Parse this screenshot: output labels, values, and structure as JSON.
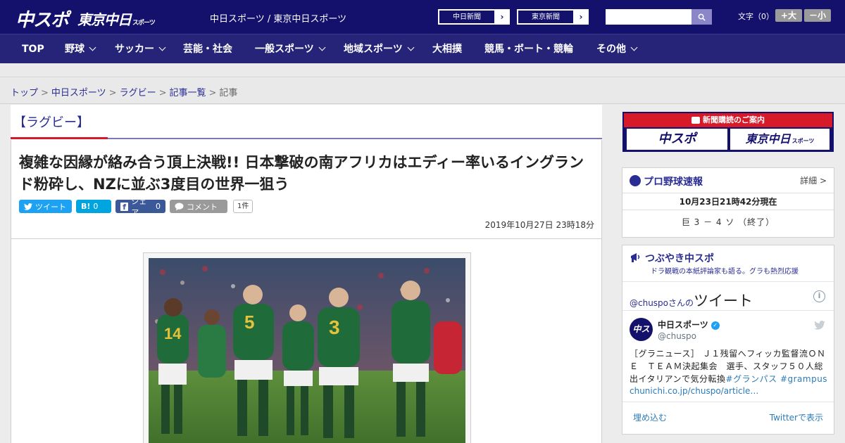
{
  "header": {
    "logo_chuspo": "中スポ",
    "logo_tokyo": "東京中日",
    "logo_tokyo_sub": "スポーツ",
    "site_name": "中日スポーツ / 東京中日スポーツ",
    "ext_links": [
      "中日新聞",
      "東京新聞"
    ],
    "search_placeholder": "",
    "fontsize_label": "文字（0）",
    "font_up": "+大",
    "font_down": "－小"
  },
  "nav": {
    "items": [
      "TOP",
      "野球",
      "サッカー",
      "芸能・社会",
      "一般スポーツ",
      "地域スポーツ",
      "大相撲",
      "競馬・ボート・競輪",
      "その他"
    ]
  },
  "breadcrumb": {
    "items": [
      "トップ",
      "中日スポーツ",
      "ラグビー",
      "記事一覧"
    ],
    "current": "記事",
    "sep": ">"
  },
  "article": {
    "category": "【ラグビー】",
    "headline": "複雑な因縁が絡み合う頂上決戦!! 日本撃破の南アフリカはエディー率いるイングランド粉砕し、NZに並ぶ3度目の世界一狙う",
    "share": {
      "tweet": "ツイート",
      "hatena_icon": "B!",
      "hatena_count": "0",
      "facebook": "シェア",
      "facebook_count": "0",
      "comment": "コメント",
      "comment_count": "1件"
    },
    "date": "2019年10月27日 23時18分"
  },
  "sidebar": {
    "ad_title": "新聞購読のご案内",
    "ad_logo_1": "中スポ",
    "ad_logo_2": "東京中日",
    "ad_logo_2_sub": "スポーツ",
    "baseball": {
      "title": "プロ野球速報",
      "more": "詳細 >",
      "time": "10月23日21時42分現在",
      "score": "巨 3 － 4 ソ （終了）"
    },
    "tsubuyaki": {
      "title": "つぶやき中スポ",
      "subtitle": "ドラ観戦の本紙評論家も語る。グラも熱烈応援",
      "tweets_by_handle": "@chuspo",
      "tweets_by_suffix": "さんの",
      "tweets_by_word": "ツイート",
      "name": "中日スポーツ",
      "handle": "@chuspo",
      "avatar_text": "中スポ",
      "body": "［グラニュース］ Ｊ１残留へフィッカ監督流ＯＮＥ　ＴＥＡＭ決起集会　選手、スタッフ５０人総出イタリアンで気分転換",
      "tag1": "#グランパス",
      "tag2": "#grampus",
      "link": "chunichi.co.jp/chuspo/article…",
      "embed": "埋め込む",
      "view_on_twitter": "Twitterで表示"
    }
  },
  "colors": {
    "brand_navy": "#13116b",
    "nav_bg": "#262478",
    "accent_red": "#d71a29",
    "link_blue": "#2a2d94",
    "twitter": "#1da1f2",
    "hatena": "#00a4de",
    "facebook": "#3b5998"
  }
}
